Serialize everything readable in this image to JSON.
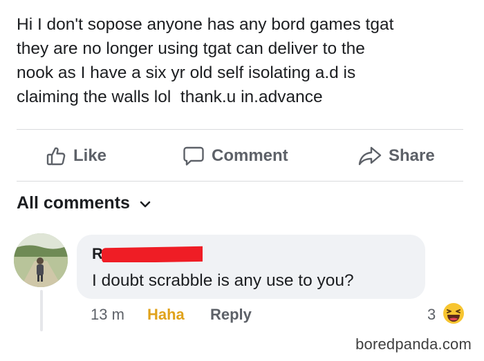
{
  "post": {
    "text": "Hi I don't sopose anyone has any bord games tgat\nthey are no longer using tgat can deliver to the\nnook as I have a six yr old self isolating a.d is\nclaiming the walls lol  thank.u in.advance"
  },
  "actions": {
    "like_label": "Like",
    "comment_label": "Comment",
    "share_label": "Share"
  },
  "comments_section": {
    "filter_label": "All comments"
  },
  "comment": {
    "name_visible": "R",
    "text": "I doubt scrabble is any use to you?",
    "time": "13 m",
    "reaction_label": "Haha",
    "reply_label": "Reply",
    "reaction_count": "3",
    "reaction_icon": "laughing-face-icon"
  },
  "watermark": "boredpanda.com",
  "colors": {
    "haha": "#e0a21b",
    "redaction": "#ef1d25",
    "muted": "#5d6168"
  }
}
